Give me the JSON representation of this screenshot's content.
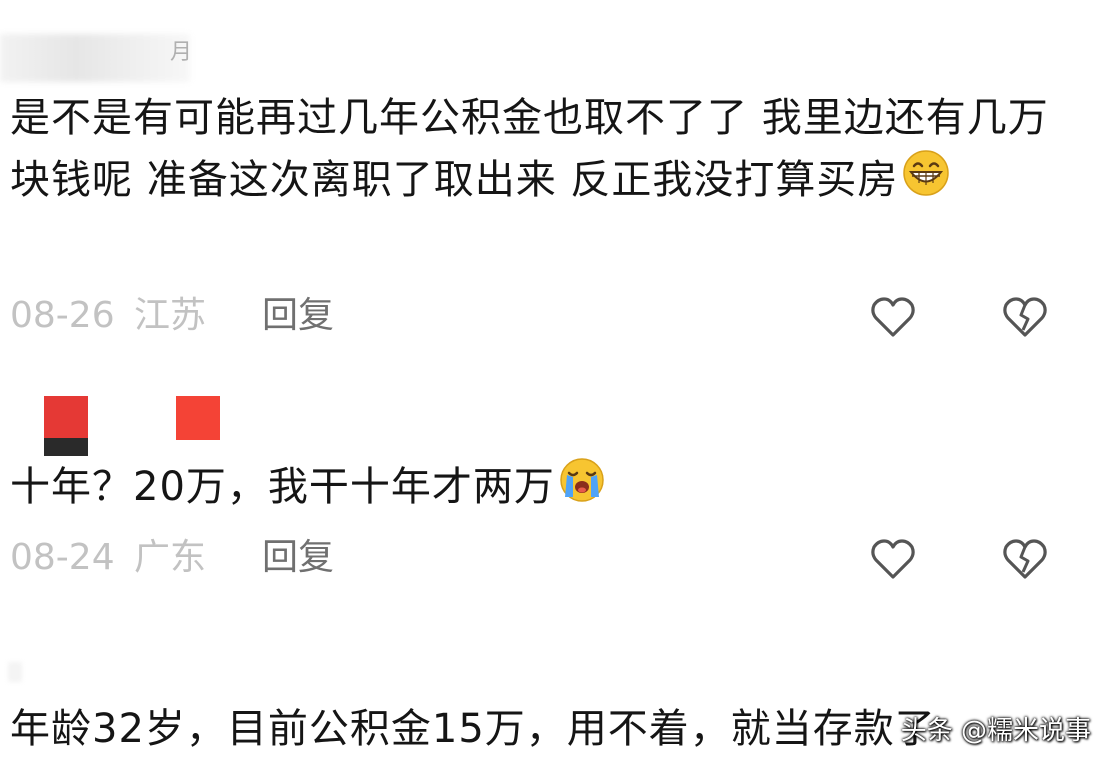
{
  "comments": [
    {
      "username": "月",
      "text": "是不是有可能再过几年公积金也取不了了 我里边还有几万块钱呢 准备这次离职了取出来 反正我没打算买房",
      "emoji": "grinning-face-emoji",
      "date": "08-26",
      "region": "江苏",
      "reply_label": "回复"
    },
    {
      "username": "",
      "avatar_colors": [
        "#e53935",
        "#f44336"
      ],
      "text": "十年？20万，我干十年才两万",
      "emoji": "loudly-crying-face-emoji",
      "date": "08-24",
      "region": "广东",
      "reply_label": "回复"
    },
    {
      "username": "",
      "text": "年龄32岁，目前公积金15万，用不着，就当存款了"
    }
  ],
  "watermark": "头条 @糯米说事",
  "icons": {
    "like": "heart-outline-icon",
    "dislike": "broken-heart-icon"
  }
}
